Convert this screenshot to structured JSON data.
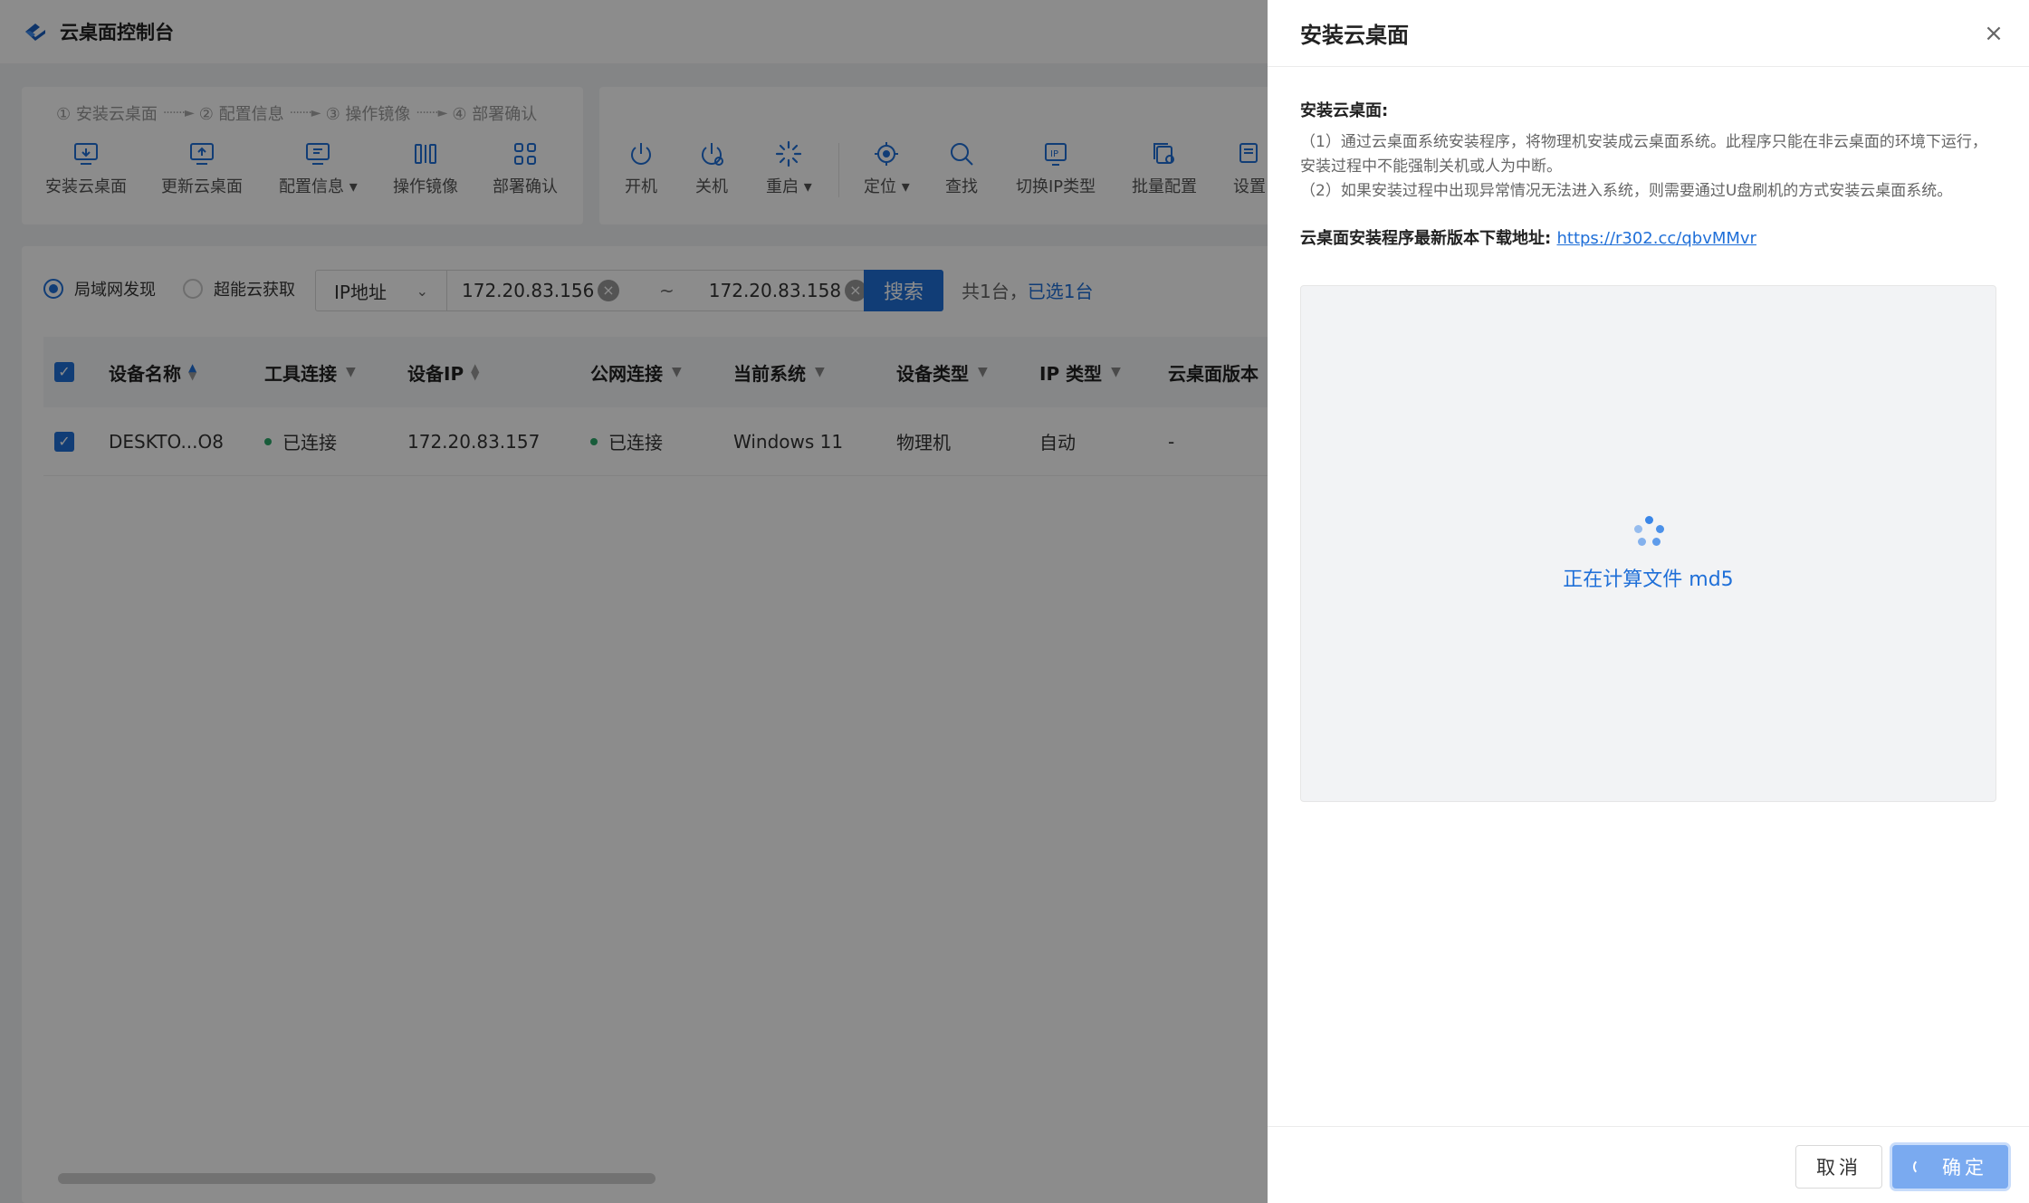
{
  "header": {
    "title": "云桌面控制台"
  },
  "steps": [
    "① 安装云桌面",
    "② 配置信息",
    "③ 操作镜像",
    "④ 部署确认"
  ],
  "deploy_tools": [
    {
      "label": "安装云桌面",
      "icon": "install-desktop-icon"
    },
    {
      "label": "更新云桌面",
      "icon": "update-desktop-icon"
    },
    {
      "label": "配置信息",
      "icon": "config-info-icon",
      "dropdown": true
    },
    {
      "label": "操作镜像",
      "icon": "image-operation-icon"
    },
    {
      "label": "部署确认",
      "icon": "deploy-confirm-icon"
    }
  ],
  "device_tools": [
    {
      "label": "开机",
      "icon": "power-on-icon"
    },
    {
      "label": "关机",
      "icon": "power-off-icon"
    },
    {
      "label": "重启",
      "icon": "restart-icon",
      "dropdown": true
    },
    {
      "label": "定位",
      "icon": "locate-icon",
      "dropdown": true
    },
    {
      "label": "查找",
      "icon": "search-icon"
    },
    {
      "label": "切换IP类型",
      "icon": "switch-ip-icon"
    },
    {
      "label": "批量配置",
      "icon": "batch-config-icon"
    },
    {
      "label": "设置",
      "icon": "settings-icon"
    }
  ],
  "search": {
    "mode_lan": "局域网发现",
    "mode_cloud": "超能云获取",
    "field": "IP地址",
    "ip_start": "172.20.83.156",
    "tilde": "~",
    "ip_end": "172.20.83.158",
    "button": "搜索",
    "count": "共1台，",
    "selected": "已选1台"
  },
  "table": {
    "columns": [
      "设备名称",
      "工具连接",
      "设备IP",
      "公网连接",
      "当前系统",
      "设备类型",
      "IP 类型",
      "云桌面版本"
    ],
    "rows": [
      {
        "name": "DESKTO...O8",
        "tool_conn": "已连接",
        "ip": "172.20.83.157",
        "public_conn": "已连接",
        "os": "Windows 11",
        "type": "物理机",
        "ip_type": "自动",
        "version": "-"
      }
    ]
  },
  "drawer": {
    "title": "安装云桌面",
    "close": "×",
    "section_title": "安装云桌面:",
    "note1": "（1）通过云桌面系统安装程序，将物理机安装成云桌面系统。此程序只能在非云桌面的环境下运行，安装过程中不能强制关机或人为中断。",
    "note2": "（2）如果安装过程中出现异常情况无法进入系统，则需要通过U盘刷机的方式安装云桌面系统。",
    "download_label": "云桌面安装程序最新版本下载地址:",
    "download_link": "https://r302.cc/qbvMMvr",
    "progress_text": "正在计算文件 md5",
    "cancel": "取消",
    "ok": "确定"
  },
  "colors": {
    "primary": "#1f6fd8",
    "connected": "#2ca86a",
    "ok_disabled": "#7aaaf0"
  }
}
